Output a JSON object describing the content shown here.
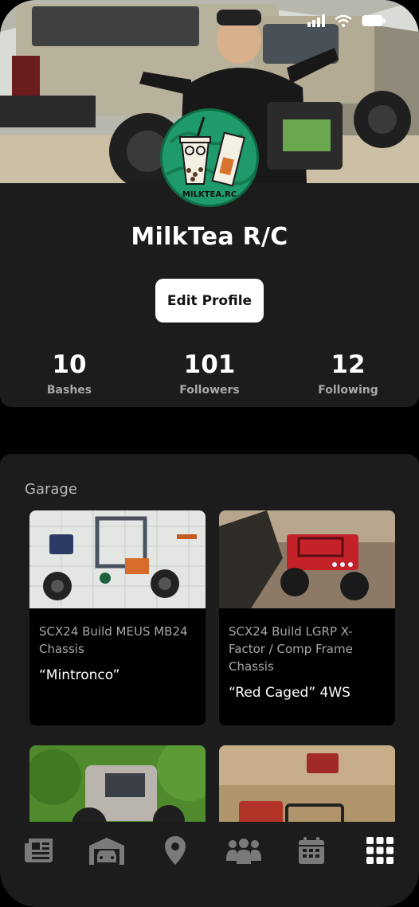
{
  "profile": {
    "name": "MilkTea R/C",
    "edit_label": "Edit Profile",
    "avatar_text": "MILKTEA.RC"
  },
  "stats": [
    {
      "value": "10",
      "label": "Bashes"
    },
    {
      "value": "101",
      "label": "Followers"
    },
    {
      "value": "12",
      "label": "Following"
    }
  ],
  "garage": {
    "title": "Garage",
    "cards": [
      {
        "title": "SCX24 Build MEUS MB24 Chassis",
        "subtitle": "“Mintronco”"
      },
      {
        "title": "SCX24 Build LGRP X-Factor / Comp Frame Chassis",
        "subtitle": "“Red Caged” 4WS"
      },
      {
        "title": "",
        "subtitle": ""
      },
      {
        "title": "",
        "subtitle": ""
      }
    ]
  },
  "nav": [
    "news-icon",
    "garage-icon",
    "location-pin-icon",
    "community-icon",
    "calendar-icon",
    "grid-menu-icon"
  ],
  "colors": {
    "background": "#000000",
    "surface": "#1c1c1c",
    "avatar_green": "#1f9a6a",
    "muted_text": "#a9a9a9"
  }
}
